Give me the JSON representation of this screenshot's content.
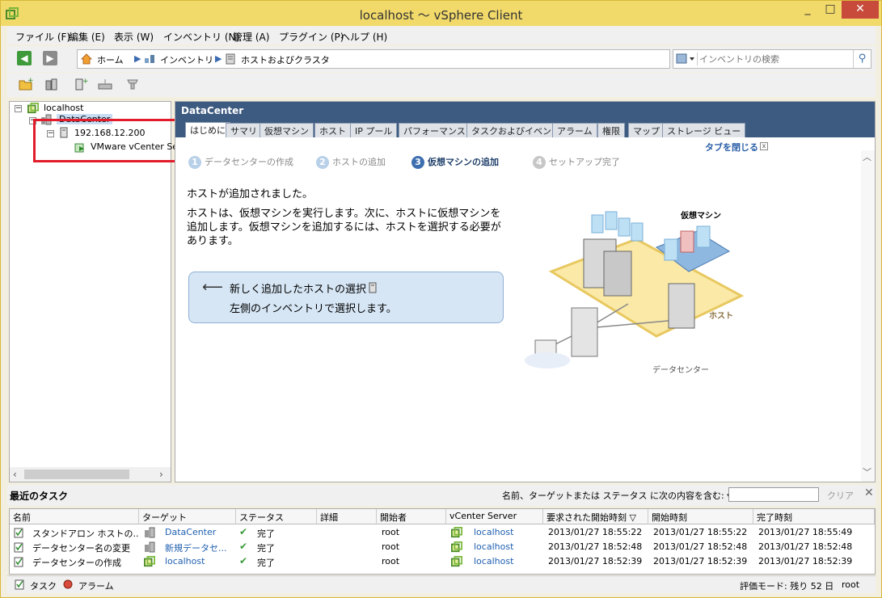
{
  "window": {
    "title": "localhost ～ vSphere Client",
    "min": "_",
    "max": "□",
    "close": "✕"
  },
  "menu": [
    "ファイル (F)",
    "編集 (E)",
    "表示 (W)",
    "インベントリ (N)",
    "管理 (A)",
    "プラグイン (P)",
    "ヘルプ (H)"
  ],
  "breadcrumb": [
    "ホーム",
    "インベントリ",
    "ホストおよびクラスタ"
  ],
  "search": {
    "placeholder": "インベントリの検索"
  },
  "tree": {
    "root": "localhost",
    "datacenter": "DataCenter",
    "host": "192.168.12.200",
    "vm": "VMware vCenter Se"
  },
  "panel": {
    "title": "DataCenter",
    "tabs": [
      "はじめに",
      "サマリ",
      "仮想マシン",
      "ホスト",
      "IP プール",
      "パフォーマンス",
      "タスクおよびイベント",
      "アラーム",
      "権限",
      "マップ",
      "ストレージ ビュー"
    ],
    "close_tab": "タブを閉じる",
    "steps": [
      {
        "num": "1",
        "label": "データセンターの作成"
      },
      {
        "num": "2",
        "label": "ホストの追加"
      },
      {
        "num": "3",
        "label": "仮想マシンの追加"
      },
      {
        "num": "4",
        "label": "セットアップ完了"
      }
    ],
    "heading": "ホストが追加されました。",
    "body": "ホストは、仮想マシンを実行します。次に、ホストに仮想マシンを追加します。仮想マシンを追加するには、ホストを選択する必要があります。",
    "hint_line1": "新しく追加したホストの選択",
    "hint_line2": "左側のインベントリで選択します。",
    "illus_vm": "仮想マシン",
    "illus_host": "ホスト",
    "illus_dc": "データセンター"
  },
  "tasks": {
    "title": "最近のタスク",
    "filter_label": "名前、ターゲットまたは ステータス に次の内容を含む: ▾",
    "clear": "クリア",
    "close": "✕",
    "columns": [
      "名前",
      "ターゲット",
      "ステータス",
      "詳細",
      "開始者",
      "vCenter Server",
      "要求された開始時刻 ▽",
      "開始時刻",
      "完了時刻"
    ],
    "rows": [
      [
        "スタンドアロン ホストの...",
        "DataCenter",
        "完了",
        "",
        "root",
        "localhost",
        "2013/01/27 18:55:22",
        "2013/01/27 18:55:22",
        "2013/01/27 18:55:49"
      ],
      [
        "データセンター名の変更",
        "新規データセ...",
        "完了",
        "",
        "root",
        "localhost",
        "2013/01/27 18:52:48",
        "2013/01/27 18:52:48",
        "2013/01/27 18:52:48"
      ],
      [
        "データセンターの作成",
        "localhost",
        "完了",
        "",
        "root",
        "localhost",
        "2013/01/27 18:52:39",
        "2013/01/27 18:52:39",
        "2013/01/27 18:52:39"
      ]
    ]
  },
  "status": {
    "tasks": "タスク",
    "alarms": "アラーム",
    "eval": "評価モード: 残り 52 日",
    "user": "root"
  }
}
